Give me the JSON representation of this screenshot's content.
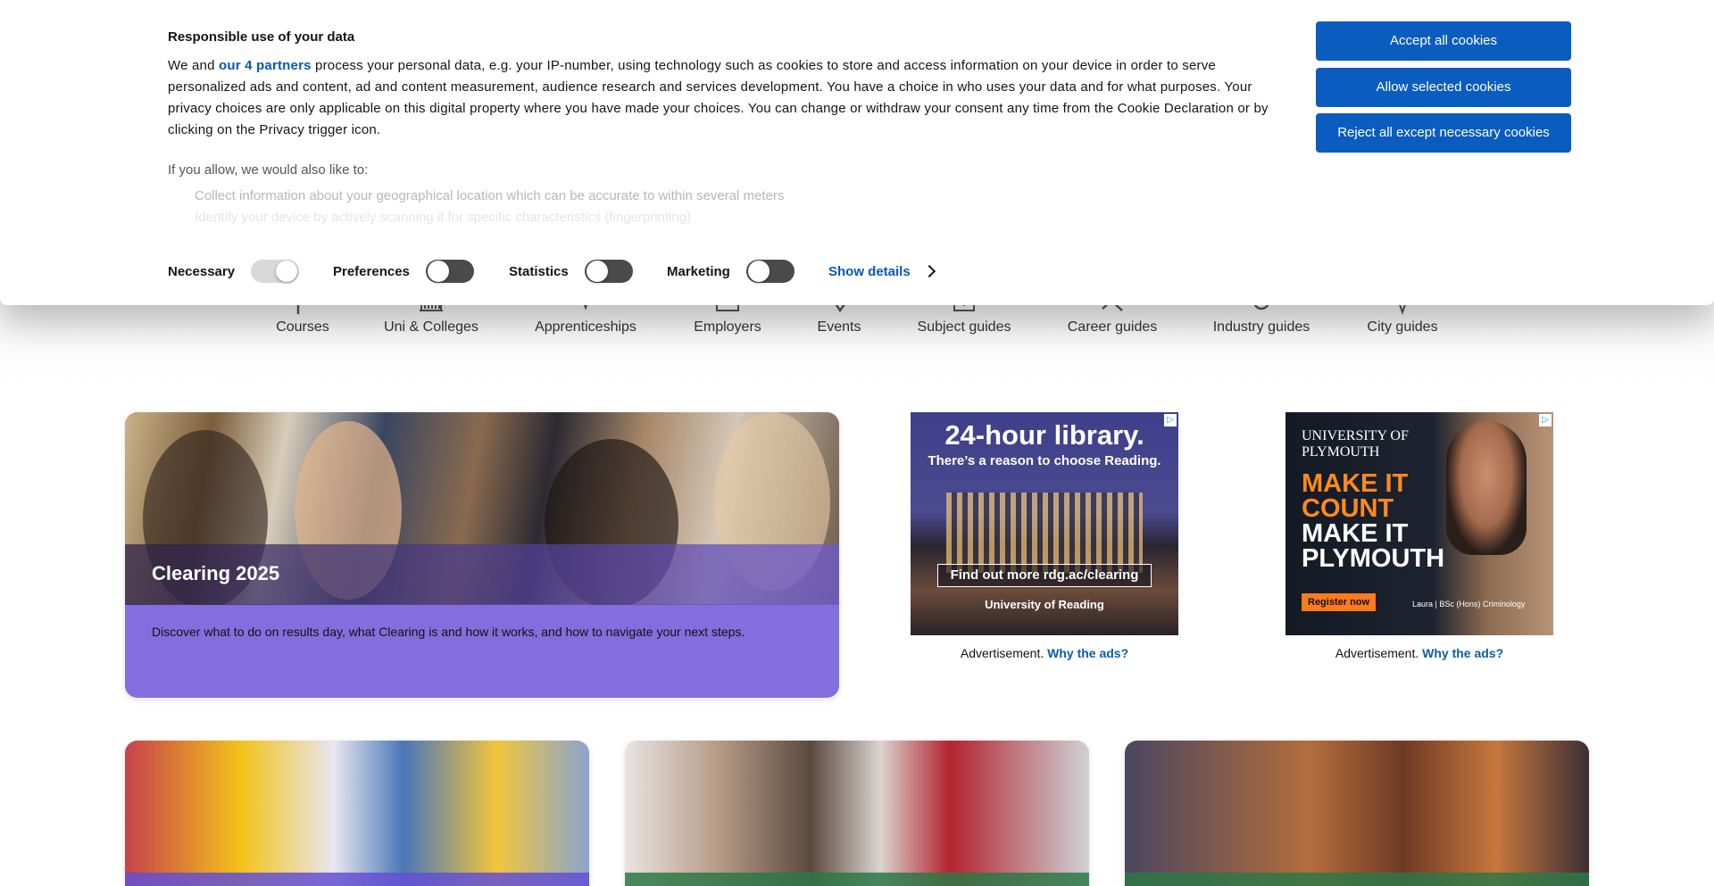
{
  "banner": {
    "title": "Responsible use of your data",
    "text_before_link": "We and ",
    "partners_link": "our 4 partners",
    "text_after_link": " process your personal data, e.g. your IP-number, using technology such as cookies to store and access information on your device in order to serve personalized ads and content, ad and content measurement, audience research and services development. You have a choice in who uses your data and for what purposes. Your privacy choices are only applicable on this digital property where you have made your choices. You can change or withdraw your consent any time from the Cookie Declaration or by clicking on the Privacy trigger icon.",
    "allow_intro": "If you allow, we would also like to:",
    "purposes": [
      "Collect information about your geographical location which can be accurate to within several meters",
      "Identify your device by actively scanning it for specific characteristics (fingerprinting)"
    ],
    "buttons": {
      "accept_all": "Accept all cookies",
      "allow_selected": "Allow selected cookies",
      "reject_all": "Reject all except necessary cookies"
    },
    "toggles": [
      {
        "label": "Necessary",
        "on": true
      },
      {
        "label": "Preferences",
        "on": false
      },
      {
        "label": "Statistics",
        "on": false
      },
      {
        "label": "Marketing",
        "on": false
      }
    ],
    "show_details": "Show details"
  },
  "nav": {
    "items": [
      {
        "label": "Courses",
        "icon": "flag-icon"
      },
      {
        "label": "Uni & Colleges",
        "icon": "building-icon"
      },
      {
        "label": "Apprenticeships",
        "icon": "person-icon"
      },
      {
        "label": "Employers",
        "icon": "briefcase-icon"
      },
      {
        "label": "Events",
        "icon": "pin-icon"
      },
      {
        "label": "Subject guides",
        "icon": "book-icon"
      },
      {
        "label": "Career guides",
        "icon": "tools-icon"
      },
      {
        "label": "Industry guides",
        "icon": "gear-icon"
      },
      {
        "label": "City guides",
        "icon": "map-pin-icon"
      }
    ]
  },
  "hero": {
    "title": "Clearing 2025",
    "description": "Discover what to do on results day, what Clearing is and how it works, and how to navigate your next steps."
  },
  "ads": {
    "reading": {
      "headline": "24-hour library.",
      "subline": "There’s a reason to choose Reading.",
      "cta": "Find out more rdg.ac/clearing",
      "logo": "University of Reading"
    },
    "plymouth": {
      "uni_line1": "UNIVERSITY OF",
      "uni_line2": "PLYMOUTH",
      "line1": "MAKE IT",
      "line2": "COUNT",
      "line3": "MAKE IT",
      "line4": "PLYMOUTH",
      "button": "Register now",
      "caption": "Laura | BSc (Hons) Criminology"
    },
    "label": "Advertisement.",
    "why": "Why the ads?"
  },
  "colors": {
    "primary_button": "#0a5cbf",
    "link": "#0a58b5",
    "hero_purple": "#826fdd"
  }
}
